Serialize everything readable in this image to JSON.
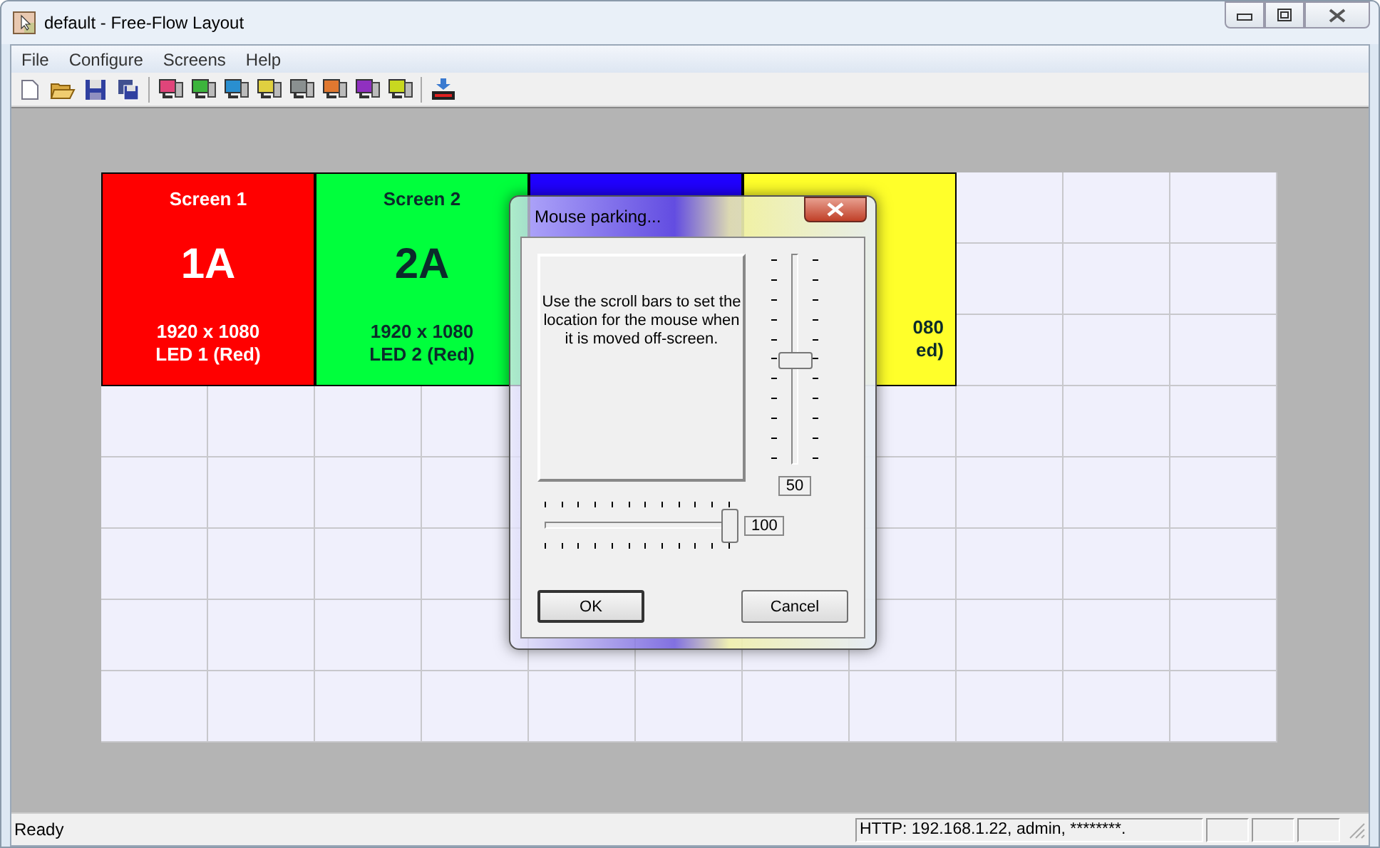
{
  "window": {
    "title": "default - Free-Flow Layout"
  },
  "menu": [
    "File",
    "Configure",
    "Screens",
    "Help"
  ],
  "toolbar": {
    "file_tools": [
      {
        "kind": "new"
      },
      {
        "kind": "open"
      },
      {
        "kind": "save"
      },
      {
        "kind": "save-all"
      }
    ],
    "screen_tools": [
      {
        "color": "#e0457a"
      },
      {
        "color": "#3cb43c"
      },
      {
        "color": "#2a8fd0"
      },
      {
        "color": "#e0d040"
      },
      {
        "color": "#8a9090"
      },
      {
        "color": "#e07830"
      },
      {
        "color": "#9030c0"
      },
      {
        "color": "#c8d820"
      }
    ],
    "extra_tools": [
      {
        "kind": "download"
      }
    ]
  },
  "screens": [
    {
      "kind": "full",
      "color": "#ff0000",
      "title": "Screen 1",
      "id": "1A",
      "resolution": "1920 x 1080",
      "led": "LED 1 (Red)",
      "light_text": true
    },
    {
      "kind": "full",
      "color": "#00ff3c",
      "title": "Screen 2",
      "id": "2A",
      "resolution": "1920 x 1080",
      "led": "LED 2 (Red)",
      "light_text": false
    },
    {
      "kind": "hidden",
      "color": "#2000ff"
    },
    {
      "kind": "partial",
      "color": "#ffff2a",
      "resolution": "080",
      "led": "ed)",
      "light_text": false
    }
  ],
  "dialog": {
    "title": "Mouse parking...",
    "instructions": "Use the scroll bars to set the location for the mouse when it is moved off-screen.",
    "vertical_slider": {
      "level": 0.5,
      "reading": "50"
    },
    "horizontal_slider": {
      "level": 1.0,
      "reading": "100"
    },
    "buttons": [
      "OK",
      "Cancel"
    ]
  },
  "status_bar": {
    "message": "Ready",
    "connection": "HTTP: 192.168.1.22, admin, ********."
  }
}
